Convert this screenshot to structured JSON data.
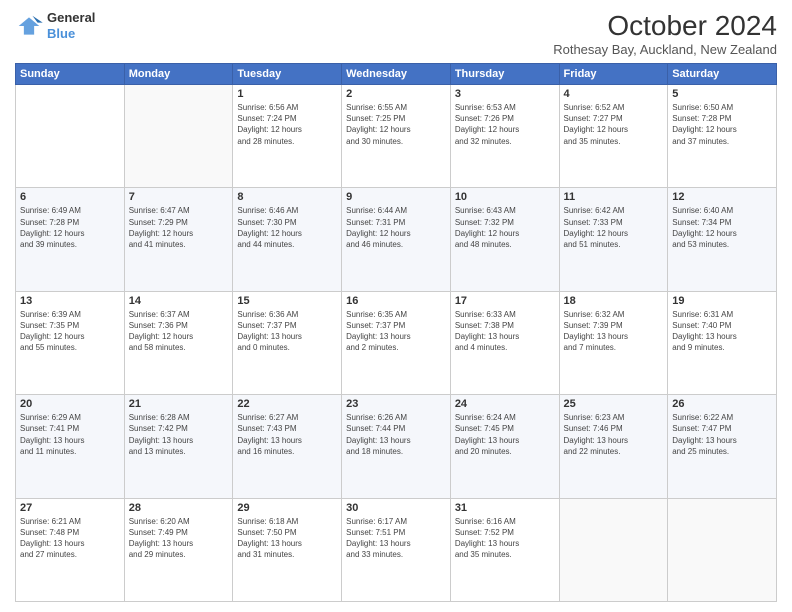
{
  "header": {
    "logo_line1": "General",
    "logo_line2": "Blue",
    "month_title": "October 2024",
    "location": "Rothesay Bay, Auckland, New Zealand"
  },
  "days_of_week": [
    "Sunday",
    "Monday",
    "Tuesday",
    "Wednesday",
    "Thursday",
    "Friday",
    "Saturday"
  ],
  "weeks": [
    [
      {
        "day": "",
        "info": ""
      },
      {
        "day": "",
        "info": ""
      },
      {
        "day": "1",
        "info": "Sunrise: 6:56 AM\nSunset: 7:24 PM\nDaylight: 12 hours\nand 28 minutes."
      },
      {
        "day": "2",
        "info": "Sunrise: 6:55 AM\nSunset: 7:25 PM\nDaylight: 12 hours\nand 30 minutes."
      },
      {
        "day": "3",
        "info": "Sunrise: 6:53 AM\nSunset: 7:26 PM\nDaylight: 12 hours\nand 32 minutes."
      },
      {
        "day": "4",
        "info": "Sunrise: 6:52 AM\nSunset: 7:27 PM\nDaylight: 12 hours\nand 35 minutes."
      },
      {
        "day": "5",
        "info": "Sunrise: 6:50 AM\nSunset: 7:28 PM\nDaylight: 12 hours\nand 37 minutes."
      }
    ],
    [
      {
        "day": "6",
        "info": "Sunrise: 6:49 AM\nSunset: 7:28 PM\nDaylight: 12 hours\nand 39 minutes."
      },
      {
        "day": "7",
        "info": "Sunrise: 6:47 AM\nSunset: 7:29 PM\nDaylight: 12 hours\nand 41 minutes."
      },
      {
        "day": "8",
        "info": "Sunrise: 6:46 AM\nSunset: 7:30 PM\nDaylight: 12 hours\nand 44 minutes."
      },
      {
        "day": "9",
        "info": "Sunrise: 6:44 AM\nSunset: 7:31 PM\nDaylight: 12 hours\nand 46 minutes."
      },
      {
        "day": "10",
        "info": "Sunrise: 6:43 AM\nSunset: 7:32 PM\nDaylight: 12 hours\nand 48 minutes."
      },
      {
        "day": "11",
        "info": "Sunrise: 6:42 AM\nSunset: 7:33 PM\nDaylight: 12 hours\nand 51 minutes."
      },
      {
        "day": "12",
        "info": "Sunrise: 6:40 AM\nSunset: 7:34 PM\nDaylight: 12 hours\nand 53 minutes."
      }
    ],
    [
      {
        "day": "13",
        "info": "Sunrise: 6:39 AM\nSunset: 7:35 PM\nDaylight: 12 hours\nand 55 minutes."
      },
      {
        "day": "14",
        "info": "Sunrise: 6:37 AM\nSunset: 7:36 PM\nDaylight: 12 hours\nand 58 minutes."
      },
      {
        "day": "15",
        "info": "Sunrise: 6:36 AM\nSunset: 7:37 PM\nDaylight: 13 hours\nand 0 minutes."
      },
      {
        "day": "16",
        "info": "Sunrise: 6:35 AM\nSunset: 7:37 PM\nDaylight: 13 hours\nand 2 minutes."
      },
      {
        "day": "17",
        "info": "Sunrise: 6:33 AM\nSunset: 7:38 PM\nDaylight: 13 hours\nand 4 minutes."
      },
      {
        "day": "18",
        "info": "Sunrise: 6:32 AM\nSunset: 7:39 PM\nDaylight: 13 hours\nand 7 minutes."
      },
      {
        "day": "19",
        "info": "Sunrise: 6:31 AM\nSunset: 7:40 PM\nDaylight: 13 hours\nand 9 minutes."
      }
    ],
    [
      {
        "day": "20",
        "info": "Sunrise: 6:29 AM\nSunset: 7:41 PM\nDaylight: 13 hours\nand 11 minutes."
      },
      {
        "day": "21",
        "info": "Sunrise: 6:28 AM\nSunset: 7:42 PM\nDaylight: 13 hours\nand 13 minutes."
      },
      {
        "day": "22",
        "info": "Sunrise: 6:27 AM\nSunset: 7:43 PM\nDaylight: 13 hours\nand 16 minutes."
      },
      {
        "day": "23",
        "info": "Sunrise: 6:26 AM\nSunset: 7:44 PM\nDaylight: 13 hours\nand 18 minutes."
      },
      {
        "day": "24",
        "info": "Sunrise: 6:24 AM\nSunset: 7:45 PM\nDaylight: 13 hours\nand 20 minutes."
      },
      {
        "day": "25",
        "info": "Sunrise: 6:23 AM\nSunset: 7:46 PM\nDaylight: 13 hours\nand 22 minutes."
      },
      {
        "day": "26",
        "info": "Sunrise: 6:22 AM\nSunset: 7:47 PM\nDaylight: 13 hours\nand 25 minutes."
      }
    ],
    [
      {
        "day": "27",
        "info": "Sunrise: 6:21 AM\nSunset: 7:48 PM\nDaylight: 13 hours\nand 27 minutes."
      },
      {
        "day": "28",
        "info": "Sunrise: 6:20 AM\nSunset: 7:49 PM\nDaylight: 13 hours\nand 29 minutes."
      },
      {
        "day": "29",
        "info": "Sunrise: 6:18 AM\nSunset: 7:50 PM\nDaylight: 13 hours\nand 31 minutes."
      },
      {
        "day": "30",
        "info": "Sunrise: 6:17 AM\nSunset: 7:51 PM\nDaylight: 13 hours\nand 33 minutes."
      },
      {
        "day": "31",
        "info": "Sunrise: 6:16 AM\nSunset: 7:52 PM\nDaylight: 13 hours\nand 35 minutes."
      },
      {
        "day": "",
        "info": ""
      },
      {
        "day": "",
        "info": ""
      }
    ]
  ]
}
